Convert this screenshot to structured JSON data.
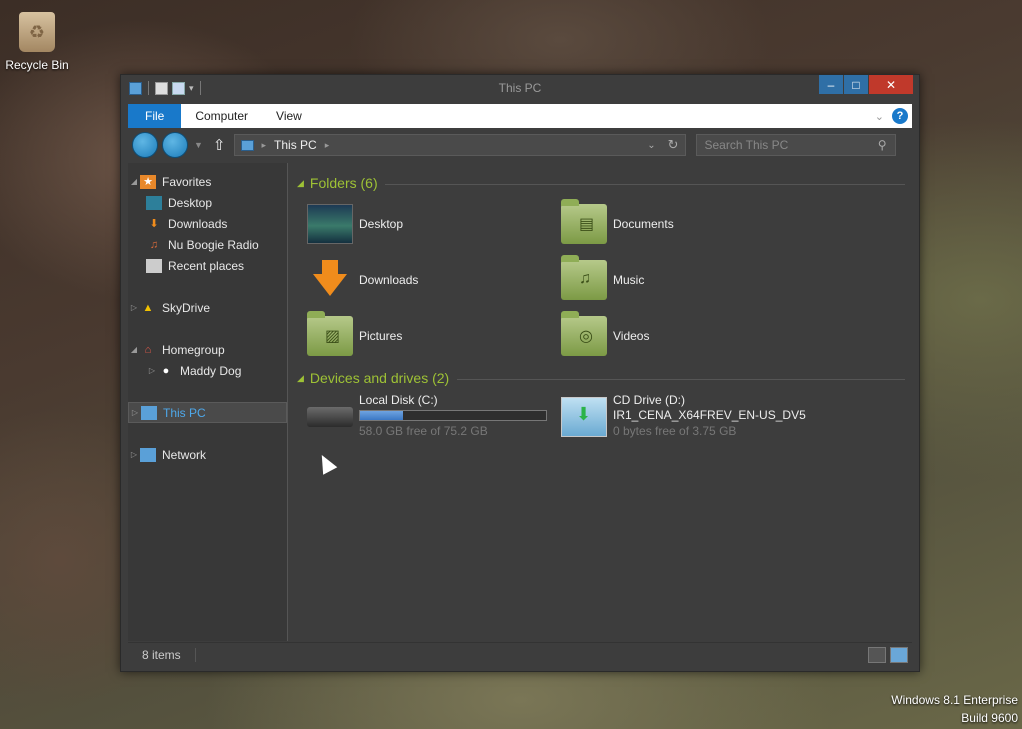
{
  "desktop": {
    "recycle_bin_label": "Recycle Bin",
    "os_edition": "Windows 8.1 Enterprise",
    "os_build": "Build 9600"
  },
  "window": {
    "title": "This PC",
    "controls": {
      "minimize": "–",
      "maximize": "□",
      "close": "✕"
    }
  },
  "ribbon": {
    "tabs": [
      "File",
      "Computer",
      "View"
    ],
    "help": "?"
  },
  "navbar": {
    "breadcrumb": [
      "This PC"
    ],
    "search_placeholder": "Search This PC"
  },
  "nav_pane": {
    "favorites": {
      "label": "Favorites",
      "items": [
        "Desktop",
        "Downloads",
        "Nu Boogie Radio",
        "Recent places"
      ]
    },
    "skydrive": "SkyDrive",
    "homegroup": {
      "label": "Homegroup",
      "items": [
        "Maddy Dog"
      ]
    },
    "this_pc": "This PC",
    "network": "Network"
  },
  "content": {
    "folders_header": "Folders (6)",
    "folders": [
      "Desktop",
      "Documents",
      "Downloads",
      "Music",
      "Pictures",
      "Videos"
    ],
    "devices_header": "Devices and drives (2)",
    "drives": [
      {
        "name": "Local Disk (C:)",
        "space": "58.0 GB free of 75.2 GB",
        "used_fraction": 0.23
      },
      {
        "name": "CD Drive (D:)",
        "label": "IR1_CENA_X64FREV_EN-US_DV5",
        "space": "0 bytes free of 3.75 GB"
      }
    ]
  },
  "status": {
    "item_count": "8 items"
  },
  "colors": {
    "accent": "#1979ca",
    "group_header": "#9ec235",
    "close": "#c0392b"
  }
}
